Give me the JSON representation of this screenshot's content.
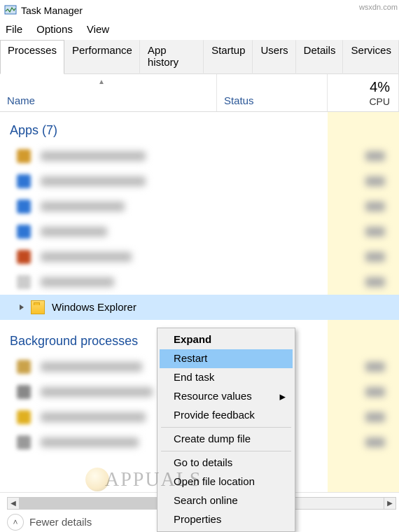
{
  "window": {
    "title": "Task Manager"
  },
  "menubar": {
    "file": "File",
    "options": "Options",
    "view": "View"
  },
  "tabs": {
    "processes": "Processes",
    "performance": "Performance",
    "app_history": "App history",
    "startup": "Startup",
    "users": "Users",
    "details": "Details",
    "services": "Services"
  },
  "columns": {
    "name": "Name",
    "status": "Status",
    "cpu_label": "CPU",
    "cpu_value": "4%"
  },
  "groups": {
    "apps_label": "Apps (7)",
    "bg_label": "Background processes"
  },
  "selected_row": {
    "name": "Windows Explorer"
  },
  "context_menu": {
    "expand": "Expand",
    "restart": "Restart",
    "end_task": "End task",
    "resource_values": "Resource values",
    "provide_feedback": "Provide feedback",
    "create_dump": "Create dump file",
    "go_to_details": "Go to details",
    "open_file_location": "Open file location",
    "search_online": "Search online",
    "properties": "Properties"
  },
  "footer": {
    "fewer_details": "Fewer details"
  },
  "watermark": {
    "brand": "APPUALS",
    "source": "wsxdn.com"
  }
}
